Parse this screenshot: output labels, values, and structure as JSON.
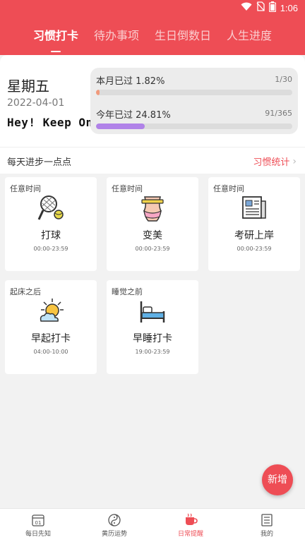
{
  "status_bar": {
    "time": "1:06"
  },
  "tabs": [
    {
      "label": "习惯打卡",
      "active": true
    },
    {
      "label": "待办事项",
      "active": false
    },
    {
      "label": "生日倒数日",
      "active": false
    },
    {
      "label": "人生进度",
      "active": false
    }
  ],
  "summary": {
    "weekday": "星期五",
    "date": "2022-04-01",
    "motto": "Hey! Keep On",
    "month_progress": {
      "label": "本月已过 1.82%",
      "count": "1/30",
      "fraction": 0.0182,
      "color": "#f19a7c"
    },
    "year_progress": {
      "label": "今年已过 24.81%",
      "count": "91/365",
      "fraction": 0.2481,
      "color": "#b082e8"
    }
  },
  "section": {
    "title": "每天进步一点点",
    "link": "习惯统计"
  },
  "habits": [
    {
      "tag": "任意时间",
      "name": "打球",
      "time": "00:00-23:59",
      "icon": "tennis-icon"
    },
    {
      "tag": "任意时间",
      "name": "变美",
      "time": "00:00-23:59",
      "icon": "waist-measure-icon"
    },
    {
      "tag": "任意时间",
      "name": "考研上岸",
      "time": "00:00-23:59",
      "icon": "newspaper-icon"
    },
    {
      "tag": "起床之后",
      "name": "早起打卡",
      "time": "04:00-10:00",
      "icon": "sun-cloud-icon"
    },
    {
      "tag": "睡觉之前",
      "name": "早睡打卡",
      "time": "19:00-23:59",
      "icon": "bed-icon"
    }
  ],
  "fab": {
    "label": "新增"
  },
  "bottom_nav": [
    {
      "label": "每日先知",
      "icon": "calendar-icon",
      "active": false
    },
    {
      "label": "黄历运势",
      "icon": "yin-yang-icon",
      "active": false
    },
    {
      "label": "日常提醒",
      "icon": "cup-icon",
      "active": true
    },
    {
      "label": "我的",
      "icon": "profile-icon",
      "active": false
    }
  ],
  "colors": {
    "brand": "#ee4d55",
    "background": "#f2f2f2"
  }
}
